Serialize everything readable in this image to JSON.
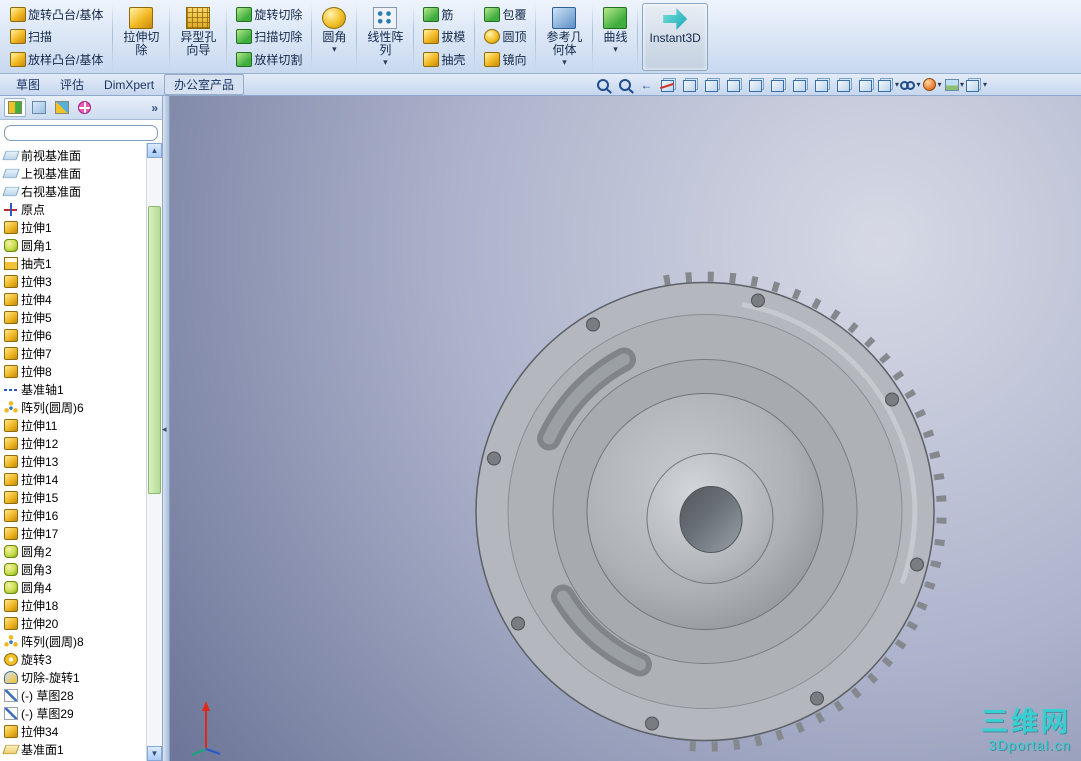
{
  "colors": {
    "ribbon-top": "#eef4fc",
    "ribbon-bottom": "#c8d9ef",
    "accent-blue": "#2a5aa0",
    "viewport-light": "#d6d9e5",
    "viewport-mid": "#adb3cc",
    "viewport-dark": "#5a6389",
    "model-gray": "#b4b8be",
    "watermark-cyan": "#2bd4d4",
    "scroll-thumb-green": "#b4dc94"
  },
  "icons": {
    "dropdown": "▾",
    "scroll_up": "▲",
    "scroll_down": "▼",
    "collapse": "◂"
  },
  "ribbon": {
    "items": [
      {
        "kind": "stack",
        "rows": [
          {
            "name": "revolved-boss-base",
            "glyph": "r-gold",
            "label": "旋转凸台/基体"
          },
          {
            "name": "swept-boss-base",
            "glyph": "r-gold",
            "label": "扫描"
          },
          {
            "name": "lofted-boss-base",
            "glyph": "r-gold",
            "label": "放样凸台/基体"
          }
        ]
      },
      {
        "kind": "big",
        "name": "extruded-cut",
        "glyph": "r-gold",
        "lines": [
          "拉伸切",
          "除"
        ],
        "dropdown": false
      },
      {
        "kind": "big",
        "name": "hole-wizard",
        "glyph": "r-grid",
        "lines": [
          "异型孔",
          "向导"
        ],
        "dropdown": false
      },
      {
        "kind": "stack",
        "rows": [
          {
            "name": "revolved-cut",
            "glyph": "r-green",
            "label": "旋转切除"
          },
          {
            "name": "swept-cut",
            "glyph": "r-green",
            "label": "扫描切除"
          },
          {
            "name": "lofted-cut",
            "glyph": "r-green",
            "label": "放样切割"
          }
        ]
      },
      {
        "kind": "big",
        "name": "fillet",
        "glyph": "r-gold-round",
        "lines": [
          "圆角"
        ],
        "dropdown": true
      },
      {
        "kind": "big",
        "name": "linear-pattern",
        "glyph": "r-dots",
        "lines": [
          "线性阵",
          "列"
        ],
        "dropdown": true
      },
      {
        "kind": "stack",
        "rows": [
          {
            "name": "rib",
            "glyph": "r-green",
            "label": "筋"
          },
          {
            "name": "draft",
            "glyph": "r-gold",
            "label": "拔模"
          },
          {
            "name": "shell",
            "glyph": "r-gold",
            "label": "抽壳"
          }
        ]
      },
      {
        "kind": "stack",
        "rows": [
          {
            "name": "wrap",
            "glyph": "r-green",
            "label": "包覆"
          },
          {
            "name": "dome",
            "glyph": "r-gold-round",
            "label": "圆顶"
          },
          {
            "name": "mirror",
            "glyph": "r-gold",
            "label": "镜向"
          }
        ]
      },
      {
        "kind": "big",
        "name": "reference-geometry",
        "glyph": "r-blue",
        "lines": [
          "参考几",
          "何体"
        ],
        "dropdown": true
      },
      {
        "kind": "big",
        "name": "curves",
        "glyph": "r-green",
        "lines": [
          "曲线"
        ],
        "dropdown": true
      },
      {
        "kind": "big",
        "name": "instant3d",
        "glyph": "r-cyan",
        "lines": [
          "Instant3D"
        ],
        "dropdown": false,
        "active": true
      }
    ]
  },
  "tabs": {
    "items": [
      {
        "name": "tab-sketch",
        "label": "草图",
        "outlined": false
      },
      {
        "name": "tab-evaluate",
        "label": "评估",
        "outlined": false
      },
      {
        "name": "tab-dimxpert",
        "label": "DimXpert",
        "outlined": false
      },
      {
        "name": "tab-office-products",
        "label": "办公室产品",
        "outlined": true
      }
    ]
  },
  "heads_up": {
    "icons": [
      {
        "name": "zoom-to-fit",
        "glyph": "mag"
      },
      {
        "name": "zoom-to-area",
        "glyph": "mag"
      },
      {
        "name": "previous-view",
        "glyph": "arrow"
      },
      {
        "name": "section-view",
        "glyph": "cubecut"
      },
      {
        "name": "view-front",
        "glyph": "cube"
      },
      {
        "name": "view-back",
        "glyph": "cube"
      },
      {
        "name": "view-left",
        "glyph": "cube"
      },
      {
        "name": "view-right",
        "glyph": "cube"
      },
      {
        "name": "view-top",
        "glyph": "cube"
      },
      {
        "name": "view-bottom",
        "glyph": "cube"
      },
      {
        "name": "view-isometric",
        "glyph": "cube"
      },
      {
        "name": "view-trimetric",
        "glyph": "cube"
      },
      {
        "name": "view-dimetric",
        "glyph": "cube"
      },
      {
        "name": "display-style",
        "glyph": "cube",
        "dropdown": true
      },
      {
        "name": "hide-show-items",
        "glyph": "glasses",
        "dropdown": true
      },
      {
        "name": "edit-appearance",
        "glyph": "ball",
        "dropdown": true
      },
      {
        "name": "apply-scene",
        "glyph": "scene",
        "dropdown": true
      },
      {
        "name": "view-settings",
        "glyph": "cube",
        "dropdown": true
      }
    ]
  },
  "panel": {
    "overflow_chevron": "»",
    "filter_value": "",
    "tabs": [
      {
        "name": "featuremanager-tab",
        "glyph": "p-feature"
      },
      {
        "name": "propertymanager-tab",
        "glyph": "p-property"
      },
      {
        "name": "configurationmanager-tab",
        "glyph": "p-config"
      },
      {
        "name": "dimxpertmanager-tab",
        "glyph": "p-dimxpert"
      }
    ]
  },
  "tree": {
    "items": [
      {
        "icon": "plane",
        "label": "前视基准面"
      },
      {
        "icon": "plane",
        "label": "上视基准面"
      },
      {
        "icon": "plane",
        "label": "右视基准面"
      },
      {
        "icon": "origin",
        "label": "原点"
      },
      {
        "icon": "extrude",
        "label": "拉伸1"
      },
      {
        "icon": "fillet",
        "label": "圆角1"
      },
      {
        "icon": "shell",
        "label": "抽壳1"
      },
      {
        "icon": "extrude",
        "label": "拉伸3"
      },
      {
        "icon": "extrude",
        "label": "拉伸4"
      },
      {
        "icon": "extrude",
        "label": "拉伸5"
      },
      {
        "icon": "extrude",
        "label": "拉伸6"
      },
      {
        "icon": "extrude",
        "label": "拉伸7"
      },
      {
        "icon": "extrude",
        "label": "拉伸8"
      },
      {
        "icon": "axis",
        "label": "基准轴1"
      },
      {
        "icon": "circular-pattern",
        "label": "阵列(圆周)6"
      },
      {
        "icon": "extrude",
        "label": "拉伸11"
      },
      {
        "icon": "extrude",
        "label": "拉伸12"
      },
      {
        "icon": "extrude",
        "label": "拉伸13"
      },
      {
        "icon": "extrude",
        "label": "拉伸14"
      },
      {
        "icon": "extrude",
        "label": "拉伸15"
      },
      {
        "icon": "extrude",
        "label": "拉伸16"
      },
      {
        "icon": "extrude",
        "label": "拉伸17"
      },
      {
        "icon": "fillet",
        "label": "圆角2"
      },
      {
        "icon": "fillet",
        "label": "圆角3"
      },
      {
        "icon": "fillet",
        "label": "圆角4"
      },
      {
        "icon": "extrude",
        "label": "拉伸18"
      },
      {
        "icon": "extrude",
        "label": "拉伸20"
      },
      {
        "icon": "circular-pattern",
        "label": "阵列(圆周)8"
      },
      {
        "icon": "revolve",
        "label": "旋转3"
      },
      {
        "icon": "cut-revolve",
        "label": "切除-旋转1"
      },
      {
        "icon": "sketch",
        "label": "(-) 草图28"
      },
      {
        "icon": "sketch",
        "label": "(-) 草图29"
      },
      {
        "icon": "extrude",
        "label": "拉伸34"
      },
      {
        "icon": "ref-plane",
        "label": "基准面1"
      }
    ]
  },
  "watermark": {
    "title": "三维网",
    "subtitle": "3Dportal.cn"
  }
}
